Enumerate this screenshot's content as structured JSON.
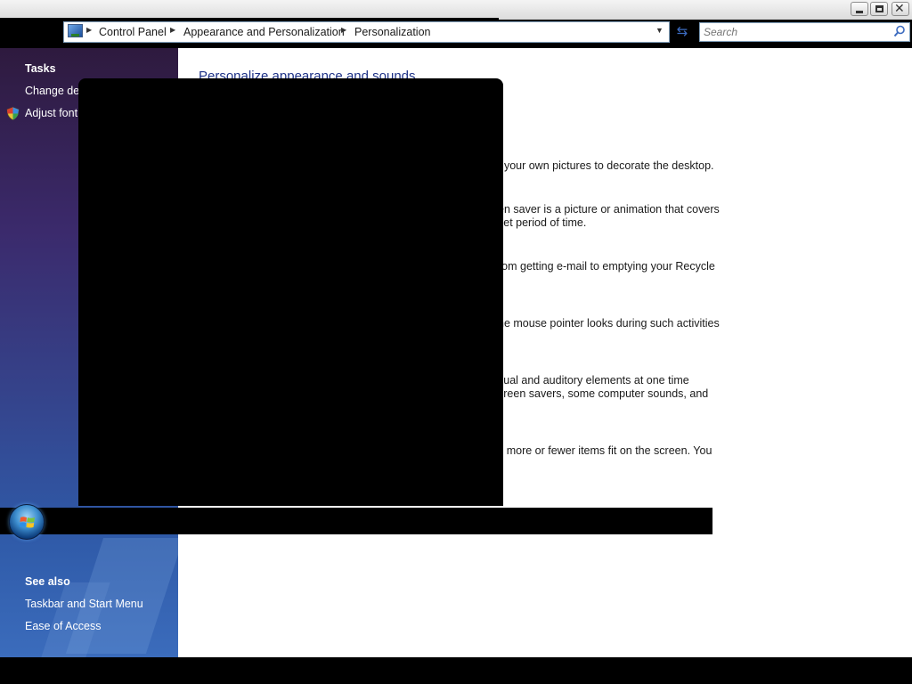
{
  "window": {
    "buttons": {
      "minimize": "minimize",
      "maximize": "restore",
      "close": "close"
    }
  },
  "address": {
    "crumbs": [
      "Control Panel",
      "Appearance and Personalization",
      "Personalization"
    ]
  },
  "search": {
    "placeholder": "Search"
  },
  "sidebar": {
    "tasks_heading": "Tasks",
    "tasks": [
      {
        "label": "Change des"
      },
      {
        "label": "Adjust font"
      }
    ],
    "see_also_heading": "See also",
    "see_also": [
      {
        "label": "Taskbar and Start Menu"
      },
      {
        "label": "Ease of Access"
      }
    ]
  },
  "content": {
    "title": "Personalize appearance and sounds",
    "descriptions": [
      "f your own pictures to decorate the desktop.",
      "en saver is a picture or animation that covers",
      "set period of time.",
      "rom getting e-mail to emptying your Recycle",
      "he mouse pointer looks during such activities",
      "sual and auditory elements at one time",
      "creen savers, some computer sounds, and",
      "s more or fewer items fit on the screen. You"
    ]
  },
  "colors": {
    "title_blue": "#1e3287",
    "sidebar_top": "#2e1a3e",
    "sidebar_bottom": "#3b6cbc"
  }
}
